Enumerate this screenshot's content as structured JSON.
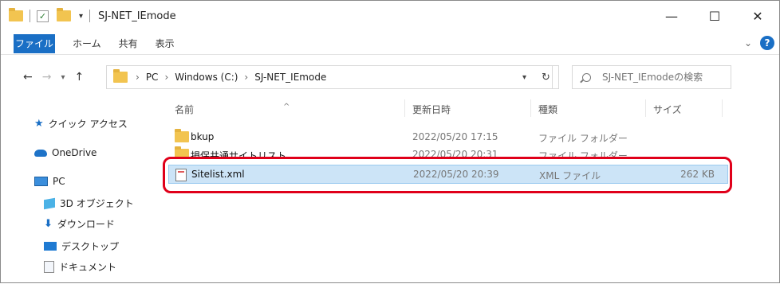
{
  "window": {
    "title": "SJ-NET_IEmode",
    "controls": [
      "—",
      "☐",
      "✕"
    ]
  },
  "quick_access_toolbar": {
    "dropdown": "▾"
  },
  "ribbon": {
    "tabs": [
      "ファイル",
      "ホーム",
      "共有",
      "表示"
    ],
    "expand": "⌄",
    "help": "?"
  },
  "nav_buttons": {
    "back": "←",
    "forward": "→",
    "recent": "▾",
    "up": "↑"
  },
  "address": {
    "crumbs": [
      "PC",
      "Windows (C:)",
      "SJ-NET_IEmode"
    ],
    "separator": "›",
    "dropdown": "▾",
    "refresh": "↻"
  },
  "search": {
    "placeholder": "SJ-NET_IEmodeの検索"
  },
  "nav_pane": {
    "items": [
      {
        "label": "クイック アクセス",
        "icon": "star-icon"
      },
      {
        "label": "OneDrive",
        "icon": "cloud-icon"
      },
      {
        "label": "PC",
        "icon": "pc-icon"
      },
      {
        "label": "3D オブジェクト",
        "icon": "cube-icon"
      },
      {
        "label": "ダウンロード",
        "icon": "download-icon"
      },
      {
        "label": "デスクトップ",
        "icon": "desktop-icon"
      },
      {
        "label": "ドキュメント",
        "icon": "document-icon"
      }
    ]
  },
  "columns": {
    "name": "名前",
    "date": "更新日時",
    "type": "種類",
    "size": "サイズ",
    "sort_indicator": "^"
  },
  "files": [
    {
      "name": "bkup",
      "date": "2022/05/20 17:15",
      "type": "ファイル フォルダー",
      "size": "",
      "icon": "folder-icon"
    },
    {
      "name": "損保共通サイトリスト",
      "date": "2022/05/20 20:31",
      "type": "ファイル フォルダー",
      "size": "",
      "icon": "folder-icon"
    },
    {
      "name": "Sitelist.xml",
      "date": "2022/05/20 20:39",
      "type": "XML ファイル",
      "size": "262 KB",
      "icon": "xml-file-icon",
      "selected": true
    }
  ],
  "colors": {
    "accent": "#1a6fc5",
    "selection": "#cce4f7",
    "highlight_border": "#e0001a"
  }
}
